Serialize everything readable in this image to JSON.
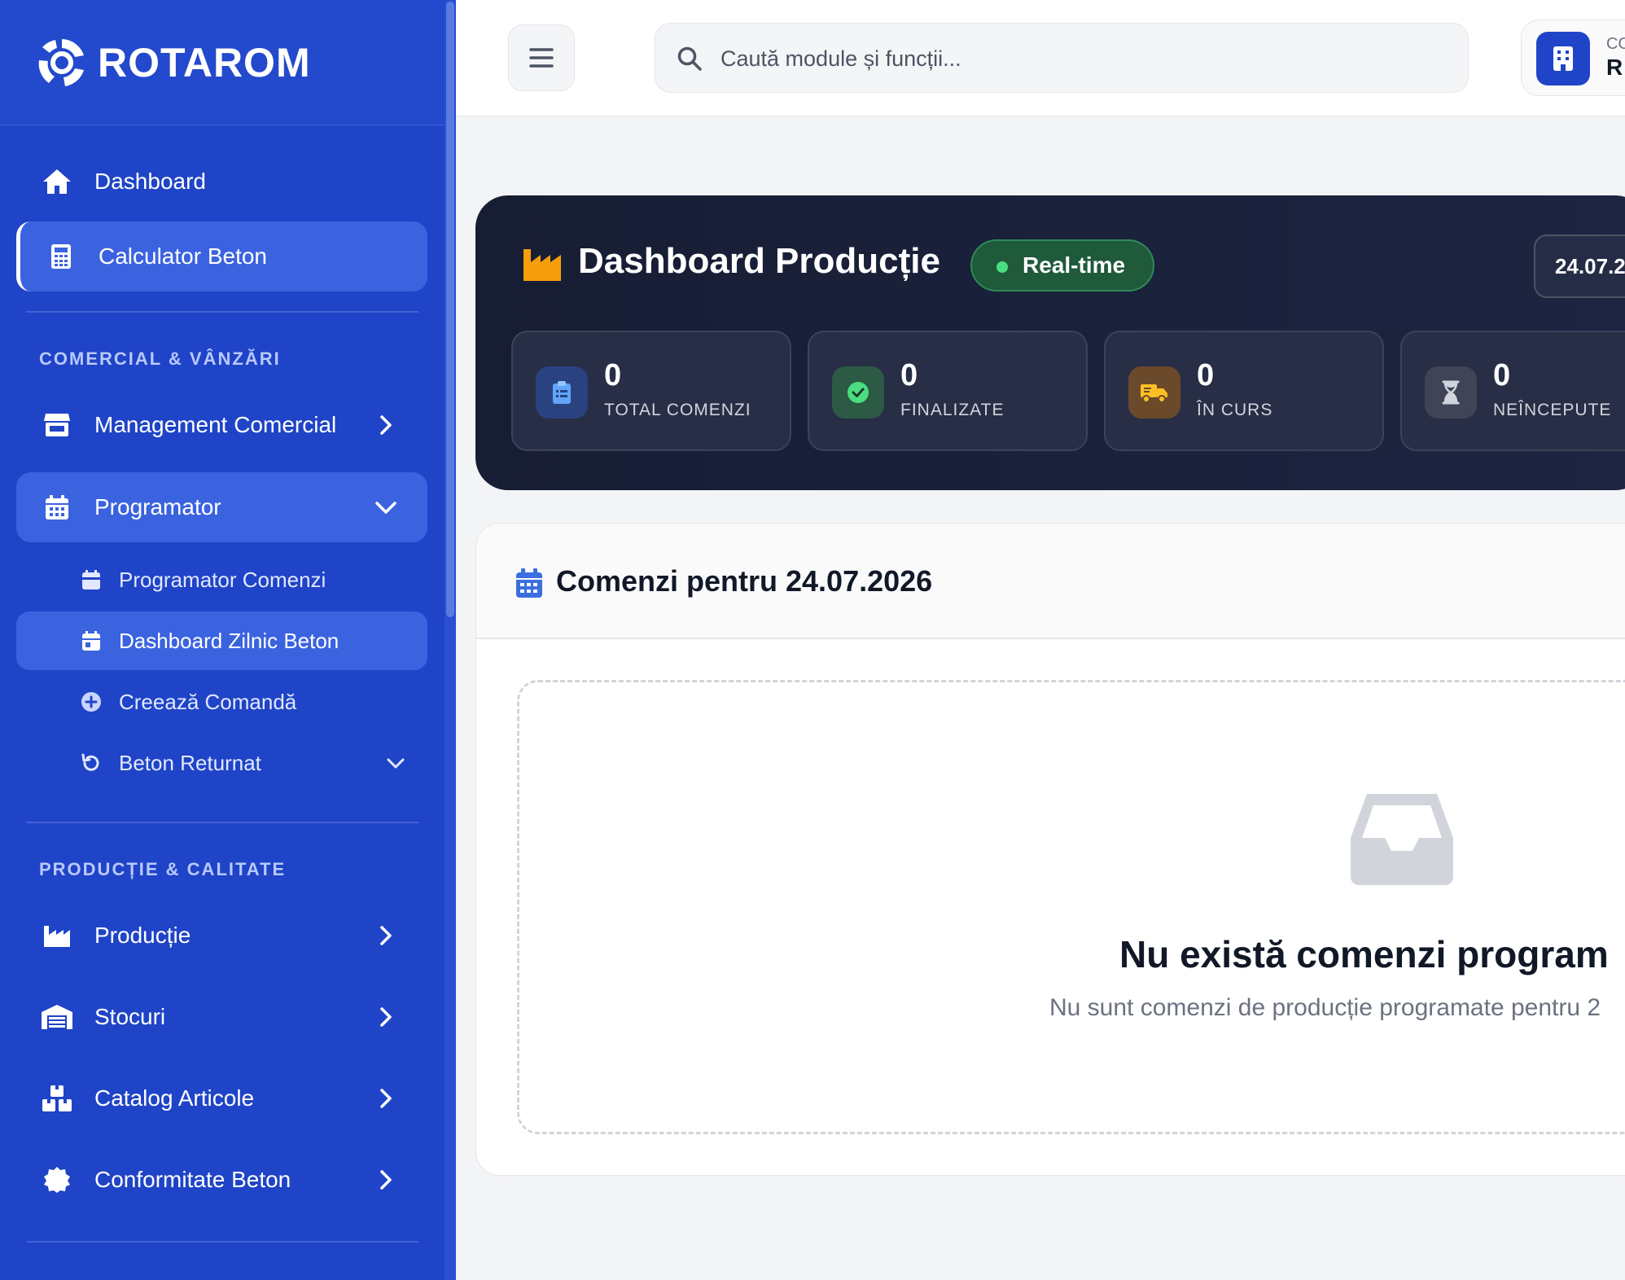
{
  "brand": {
    "name": "ROTAROM"
  },
  "colors": {
    "sidebar": "#1f44c7",
    "active": "#3b63e0",
    "hero": "#171d33",
    "realtime": "#4ade80"
  },
  "sidebar": {
    "top_items": [
      {
        "label": "Dashboard",
        "icon": "home-icon"
      },
      {
        "label": "Calculator Beton",
        "icon": "calculator-icon"
      }
    ],
    "section_commercial": "COMERCIAL & VÂNZĂRI",
    "management_comercial": "Management Comercial",
    "programator": "Programator",
    "programator_sub": [
      {
        "label": "Programator Comenzi",
        "icon": "calendar-icon"
      },
      {
        "label": "Dashboard Zilnic Beton",
        "icon": "calendar-day-icon"
      },
      {
        "label": "Creează Comandă",
        "icon": "plus-circle-icon"
      },
      {
        "label": "Beton Returnat",
        "icon": "undo-icon"
      }
    ],
    "section_production": "PRODUCȚIE & CALITATE",
    "production_items": [
      {
        "label": "Producție",
        "icon": "factory-icon"
      },
      {
        "label": "Stocuri",
        "icon": "warehouse-icon"
      },
      {
        "label": "Catalog Articole",
        "icon": "boxes-icon"
      },
      {
        "label": "Conformitate Beton",
        "icon": "certificate-icon"
      }
    ]
  },
  "header": {
    "search_placeholder": "Caută module și funcții...",
    "company_small": "CO",
    "company_big": "R"
  },
  "hero": {
    "title": "Dashboard Producție",
    "badge": "Real-time",
    "date": "24.07.2",
    "stats": [
      {
        "value": "0",
        "label": "TOTAL COMENZI",
        "icon": "clipboard-icon",
        "color": "#3b82f6"
      },
      {
        "value": "0",
        "label": "FINALIZATE",
        "icon": "check-circle-icon",
        "color": "#22c55e"
      },
      {
        "value": "0",
        "label": "ÎN CURS",
        "icon": "truck-icon",
        "color": "#f59e0b"
      },
      {
        "value": "0",
        "label": "NEÎNCEPUTE",
        "icon": "hourglass-icon",
        "color": "#9ca3af"
      }
    ]
  },
  "orders": {
    "title": "Comenzi pentru 24.07.2026",
    "empty_title": "Nu există comenzi program",
    "empty_subtitle": "Nu sunt comenzi de producție programate pentru 2"
  }
}
